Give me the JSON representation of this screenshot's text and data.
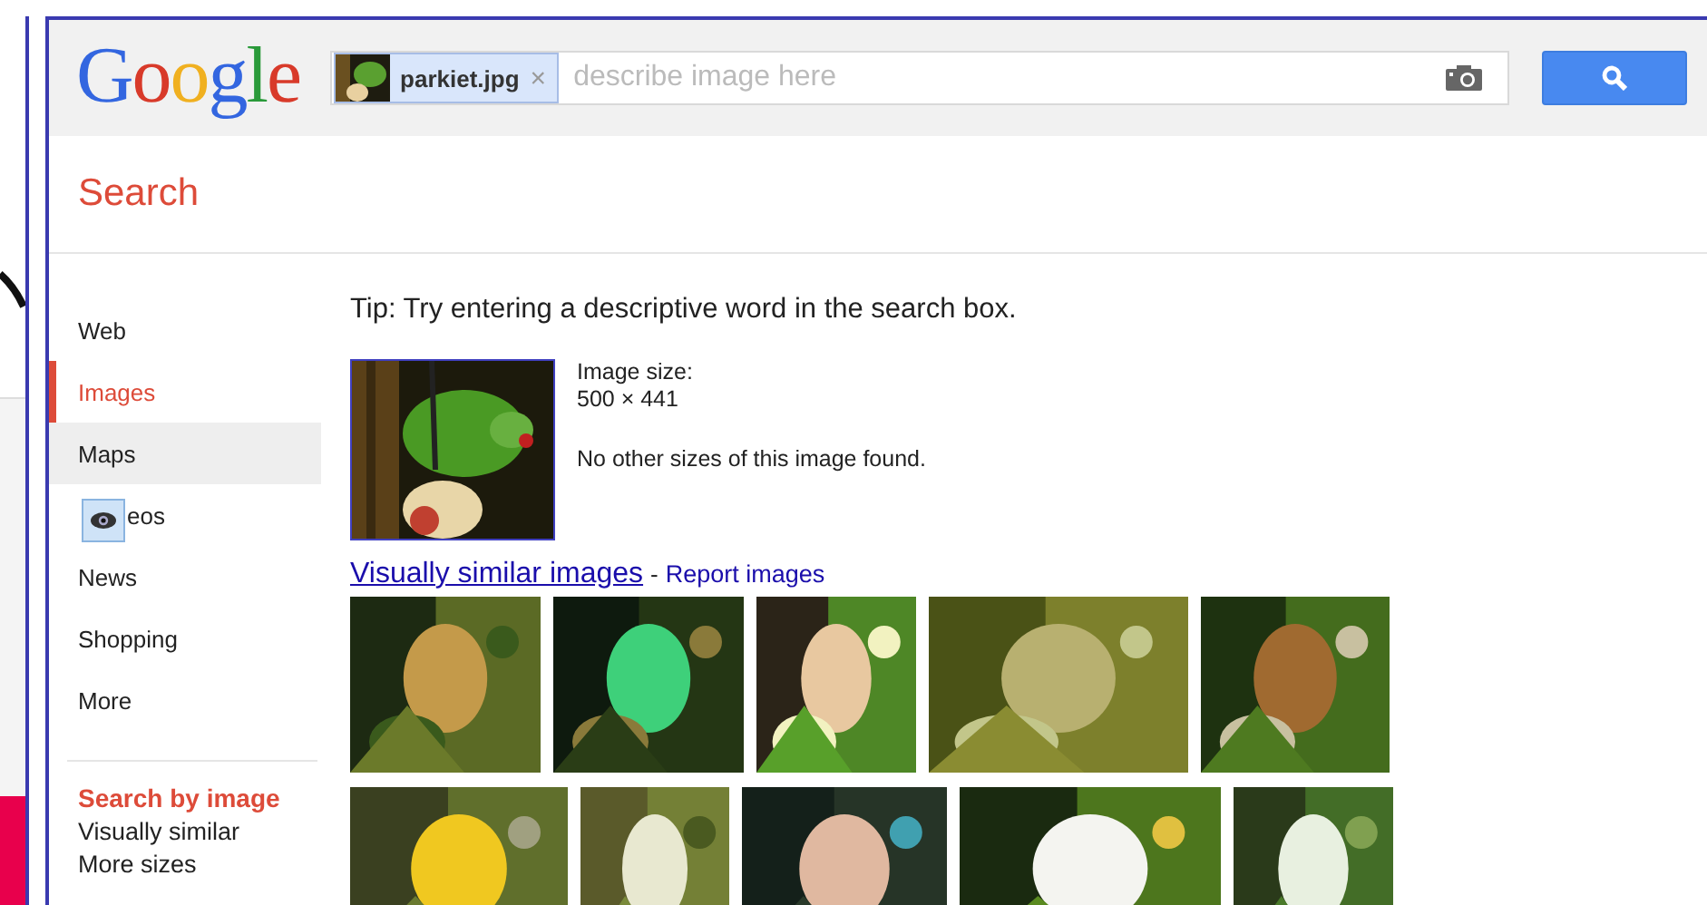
{
  "logo": "Google",
  "search": {
    "chip_label": "parkiet.jpg",
    "chip_close": "×",
    "placeholder": "describe image here"
  },
  "page_title": "Search",
  "sidebar": {
    "items": [
      {
        "label": "Web",
        "selected": false,
        "hovered": false
      },
      {
        "label": "Images",
        "selected": true,
        "hovered": false
      },
      {
        "label": "Maps",
        "selected": false,
        "hovered": true
      },
      {
        "label": "eos",
        "selected": false,
        "hovered": false
      },
      {
        "label": "News",
        "selected": false,
        "hovered": false
      },
      {
        "label": "Shopping",
        "selected": false,
        "hovered": false
      },
      {
        "label": "More",
        "selected": false,
        "hovered": false
      }
    ],
    "section_title": "Search by image",
    "section_links": [
      "Visually similar",
      "More sizes"
    ]
  },
  "tip": "Tip: Try entering a descriptive word in the search box.",
  "result": {
    "size_label": "Image size:",
    "size_value": "500 × 441",
    "note": "No other sizes of this image found."
  },
  "similar_link": "Visually similar images",
  "separator": "-",
  "report_link": "Report images"
}
